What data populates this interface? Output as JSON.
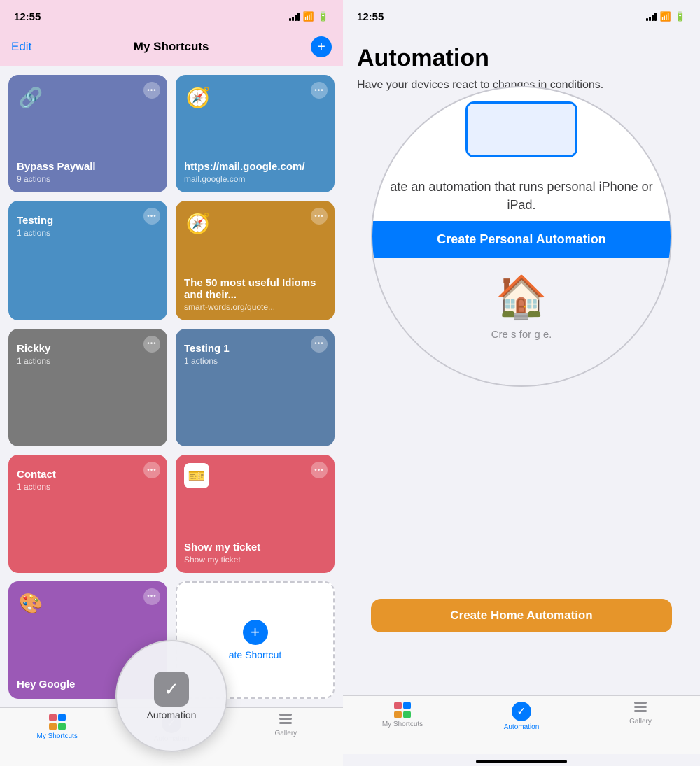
{
  "left_panel": {
    "status_bar": {
      "time": "12:55"
    },
    "header": {
      "edit_label": "Edit",
      "title": "My Shortcuts",
      "add_label": "+"
    },
    "shortcuts": [
      {
        "id": "bypass-paywall",
        "title": "Bypass Paywall",
        "subtitle": "9 actions",
        "color": "card-bypass",
        "icon_type": "link"
      },
      {
        "id": "mail-google",
        "title": "https://mail.google.com/",
        "subtitle": "mail.google.com",
        "color": "card-mail",
        "icon_type": "safari"
      },
      {
        "id": "testing",
        "title": "Testing",
        "subtitle": "1 actions",
        "color": "card-testing",
        "icon_type": "none"
      },
      {
        "id": "idioms",
        "title": "The 50 most useful Idioms and their...",
        "subtitle": "smart-words.org/quote...",
        "color": "card-idioms",
        "icon_type": "safari"
      },
      {
        "id": "rickky",
        "title": "Rickky",
        "subtitle": "1 actions",
        "color": "card-rickky",
        "icon_type": "none"
      },
      {
        "id": "testing1",
        "title": "Testing 1",
        "subtitle": "1 actions",
        "color": "card-testing1",
        "icon_type": "none"
      },
      {
        "id": "contact",
        "title": "Contact",
        "subtitle": "1 actions",
        "color": "card-contact",
        "icon_type": "none"
      },
      {
        "id": "show-my-ticket",
        "title": "Show my ticket",
        "subtitle": "Show my ticket",
        "color": "card-ticket",
        "icon_type": "ticket"
      },
      {
        "id": "hey-google",
        "title": "Hey Google",
        "subtitle": "",
        "color": "card-hey-google",
        "icon_type": "google"
      }
    ],
    "create_shortcut_label": "ate Shortcut",
    "tab_bar": {
      "items": [
        {
          "id": "my-shortcuts",
          "label": "My Shortcuts",
          "active": true
        },
        {
          "id": "automation",
          "label": "Automation",
          "active": false
        },
        {
          "id": "gallery",
          "label": "Gallery",
          "active": false
        }
      ]
    },
    "automation_circle": {
      "label": "Automation"
    }
  },
  "right_panel": {
    "status_bar": {
      "time": "12:55"
    },
    "content": {
      "title": "Automation",
      "description": "Have your devices react to changes in conditions.",
      "circle_text": "ate an automation that runs personal iPhone or iPad.",
      "create_personal_label": "Create Personal Automation",
      "home_bottom_text": "Cre                          s for g                             e.",
      "create_home_label": "Create Home Automation"
    },
    "tab_bar": {
      "items": [
        {
          "id": "my-shortcuts",
          "label": "My Shortcuts",
          "active": false
        },
        {
          "id": "automation",
          "label": "Automation",
          "active": true
        },
        {
          "id": "gallery",
          "label": "Gallery",
          "active": false
        }
      ]
    }
  }
}
